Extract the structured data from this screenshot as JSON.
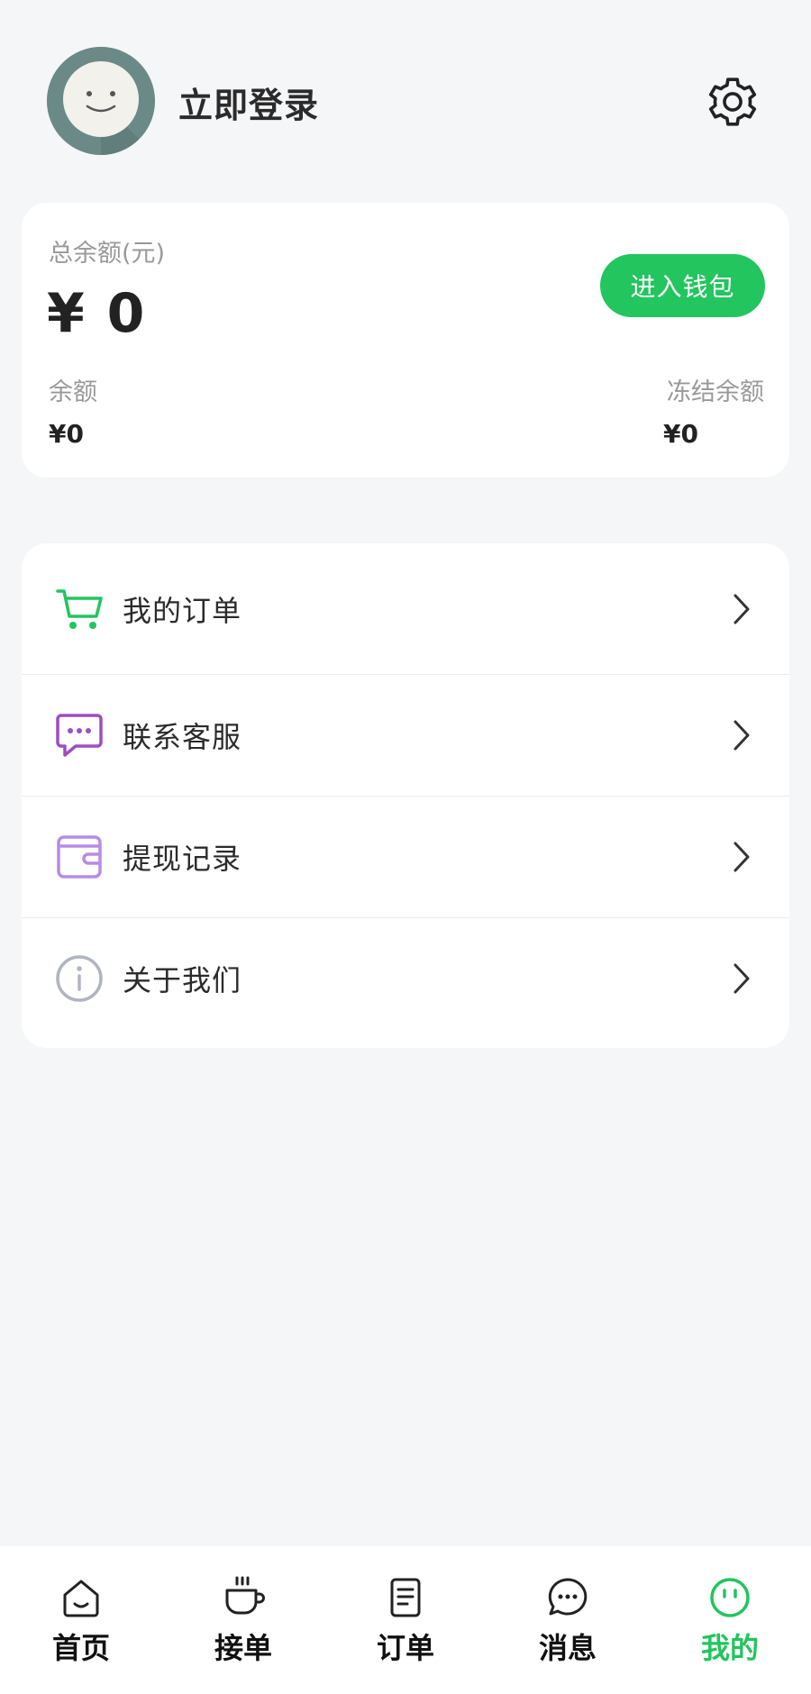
{
  "header": {
    "login_text": "立即登录",
    "avatar_icon": "smiley-face-avatar",
    "settings_icon": "gear-icon"
  },
  "balance": {
    "total_label": "总余额(元)",
    "total_value": "¥ 0",
    "wallet_button": "进入钱包",
    "available_label": "余额",
    "available_value": "¥0",
    "frozen_label": "冻结余额",
    "frozen_value": "¥0",
    "accent_color": "#22c55e"
  },
  "menu": {
    "items": [
      {
        "label": "我的订单",
        "icon": "cart-icon",
        "color": "#22c55e"
      },
      {
        "label": "联系客服",
        "icon": "chat-bubble-icon",
        "color": "#9b4fc2"
      },
      {
        "label": "提现记录",
        "icon": "wallet-icon",
        "color": "#b98ae6"
      },
      {
        "label": "关于我们",
        "icon": "info-icon",
        "color": "#b0b5c0"
      }
    ]
  },
  "bottom_nav": {
    "items": [
      {
        "label": "首页",
        "icon": "home-icon",
        "active": false
      },
      {
        "label": "接单",
        "icon": "coffee-cup-icon",
        "active": false
      },
      {
        "label": "订单",
        "icon": "document-icon",
        "active": false
      },
      {
        "label": "消息",
        "icon": "message-icon",
        "active": false
      },
      {
        "label": "我的",
        "icon": "smiley-icon",
        "active": true
      }
    ],
    "active_color": "#22c55e"
  }
}
